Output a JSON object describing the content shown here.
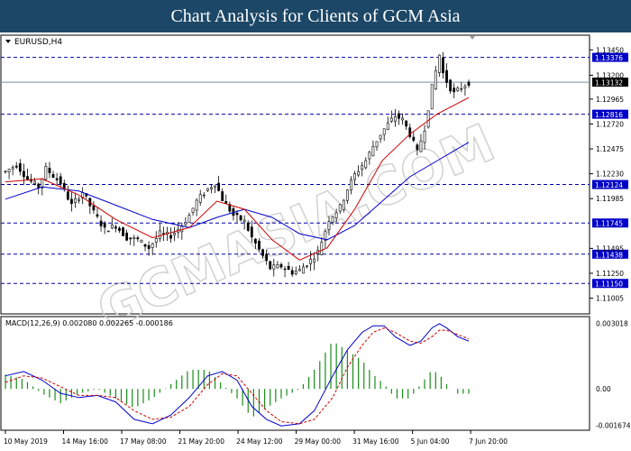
{
  "header": {
    "title": "Chart Analysis for Clients of GCM Asia"
  },
  "watermark": "GCMASIA.COM",
  "chart_data": [
    {
      "type": "candlestick",
      "title": "EURUSD,H4",
      "ylim": [
        1.1085,
        1.1355
      ],
      "y_ticks": [
        "1.13450",
        "1.13200",
        "1.12965",
        "1.12720",
        "1.12475",
        "1.12230",
        "1.11985",
        "1.11495",
        "1.11250",
        "1.11005"
      ],
      "current_price": "1.13132",
      "levels": [
        "1.13376",
        "1.12816",
        "1.12124",
        "1.11745",
        "1.11438",
        "1.11150"
      ],
      "colors": {
        "up": "#ffffff",
        "down": "#000000",
        "ma_fast": "#cc0000",
        "ma_slow": "#0000cc",
        "level": "#0000aa",
        "price_line": "#7a8da6"
      },
      "close_path": [
        [
          0,
          1.1225
        ],
        [
          6,
          1.1232
        ],
        [
          12,
          1.1218
        ],
        [
          18,
          1.121
        ],
        [
          22,
          1.1228
        ],
        [
          30,
          1.1214
        ],
        [
          36,
          1.1192
        ],
        [
          42,
          1.1205
        ],
        [
          48,
          1.1185
        ],
        [
          54,
          1.1168
        ],
        [
          60,
          1.1172
        ],
        [
          66,
          1.116
        ],
        [
          72,
          1.1158
        ],
        [
          78,
          1.115
        ],
        [
          84,
          1.1164
        ],
        [
          90,
          1.1162
        ],
        [
          96,
          1.1172
        ],
        [
          100,
          1.1182
        ],
        [
          104,
          1.1196
        ],
        [
          110,
          1.1208
        ],
        [
          114,
          1.1214
        ],
        [
          118,
          1.1198
        ],
        [
          124,
          1.1182
        ],
        [
          130,
          1.1176
        ],
        [
          134,
          1.116
        ],
        [
          140,
          1.1142
        ],
        [
          144,
          1.113
        ],
        [
          150,
          1.1132
        ],
        [
          156,
          1.1126
        ],
        [
          160,
          1.1128
        ],
        [
          166,
          1.1138
        ],
        [
          170,
          1.1146
        ],
        [
          176,
          1.1178
        ],
        [
          182,
          1.119
        ],
        [
          186,
          1.1208
        ],
        [
          190,
          1.1222
        ],
        [
          196,
          1.1236
        ],
        [
          200,
          1.125
        ],
        [
          204,
          1.1262
        ],
        [
          208,
          1.1272
        ],
        [
          212,
          1.128
        ],
        [
          216,
          1.1276
        ],
        [
          220,
          1.1262
        ],
        [
          224,
          1.1244
        ],
        [
          228,
          1.1268
        ],
        [
          232,
          1.1308
        ],
        [
          236,
          1.134
        ],
        [
          238,
          1.1322
        ],
        [
          241,
          1.131
        ],
        [
          244,
          1.1302
        ],
        [
          248,
          1.1308
        ],
        [
          252,
          1.1313
        ]
      ],
      "ma_fast": [
        [
          0,
          1.1215
        ],
        [
          20,
          1.1218
        ],
        [
          40,
          1.1202
        ],
        [
          60,
          1.1178
        ],
        [
          80,
          1.116
        ],
        [
          100,
          1.117
        ],
        [
          115,
          1.1196
        ],
        [
          130,
          1.1188
        ],
        [
          145,
          1.1158
        ],
        [
          160,
          1.1138
        ],
        [
          175,
          1.115
        ],
        [
          190,
          1.1188
        ],
        [
          205,
          1.1236
        ],
        [
          220,
          1.1262
        ],
        [
          235,
          1.1282
        ],
        [
          252,
          1.1298
        ]
      ],
      "ma_slow": [
        [
          0,
          1.1198
        ],
        [
          20,
          1.121
        ],
        [
          40,
          1.1206
        ],
        [
          60,
          1.1192
        ],
        [
          80,
          1.1178
        ],
        [
          100,
          1.117
        ],
        [
          115,
          1.118
        ],
        [
          130,
          1.1188
        ],
        [
          145,
          1.118
        ],
        [
          160,
          1.1164
        ],
        [
          175,
          1.1158
        ],
        [
          190,
          1.1172
        ],
        [
          205,
          1.1196
        ],
        [
          220,
          1.122
        ],
        [
          235,
          1.1236
        ],
        [
          252,
          1.1254
        ]
      ]
    },
    {
      "type": "macd",
      "title": "MACD(12,26,9) 0.002080 0.002265 -0.000186",
      "ylim": [
        -0.0019,
        0.0032
      ],
      "y_ticks": [
        "0.003018",
        "0.00",
        "-0.001674"
      ],
      "colors": {
        "histogram": "#1a8c1a",
        "macd": "#0000cc",
        "signal": "#cc0000"
      },
      "macd_line": [
        [
          0,
          0.0006
        ],
        [
          10,
          0.0008
        ],
        [
          20,
          0.0004
        ],
        [
          30,
          -0.0002
        ],
        [
          40,
          -0.0004
        ],
        [
          50,
          -0.0003
        ],
        [
          60,
          -0.0006
        ],
        [
          70,
          -0.0014
        ],
        [
          80,
          -0.0016
        ],
        [
          90,
          -0.0012
        ],
        [
          100,
          -0.0004
        ],
        [
          110,
          0.0006
        ],
        [
          118,
          0.0008
        ],
        [
          126,
          0.0004
        ],
        [
          134,
          -0.0008
        ],
        [
          142,
          -0.0014
        ],
        [
          150,
          -0.0017
        ],
        [
          160,
          -0.0016
        ],
        [
          168,
          -0.001
        ],
        [
          178,
          0.0006
        ],
        [
          186,
          0.0018
        ],
        [
          194,
          0.0026
        ],
        [
          200,
          0.0029
        ],
        [
          206,
          0.0029
        ],
        [
          212,
          0.0024
        ],
        [
          220,
          0.002
        ],
        [
          226,
          0.0022
        ],
        [
          232,
          0.0028
        ],
        [
          236,
          0.003
        ],
        [
          240,
          0.0028
        ],
        [
          246,
          0.0024
        ],
        [
          252,
          0.0022
        ]
      ],
      "signal_line": [
        [
          0,
          0.0003
        ],
        [
          10,
          0.0006
        ],
        [
          20,
          0.0005
        ],
        [
          30,
          0.0001
        ],
        [
          40,
          -0.0003
        ],
        [
          50,
          -0.0003
        ],
        [
          60,
          -0.0004
        ],
        [
          70,
          -0.001
        ],
        [
          80,
          -0.0014
        ],
        [
          90,
          -0.0013
        ],
        [
          100,
          -0.0008
        ],
        [
          110,
          0.0002
        ],
        [
          118,
          0.0007
        ],
        [
          126,
          0.0006
        ],
        [
          134,
          -0.0002
        ],
        [
          142,
          -0.001
        ],
        [
          150,
          -0.0015
        ],
        [
          160,
          -0.0016
        ],
        [
          168,
          -0.0014
        ],
        [
          178,
          -0.0004
        ],
        [
          186,
          0.001
        ],
        [
          194,
          0.002
        ],
        [
          200,
          0.0026
        ],
        [
          206,
          0.0028
        ],
        [
          212,
          0.0026
        ],
        [
          220,
          0.0022
        ],
        [
          226,
          0.0021
        ],
        [
          232,
          0.0024
        ],
        [
          236,
          0.0027
        ],
        [
          240,
          0.0027
        ],
        [
          246,
          0.0025
        ],
        [
          252,
          0.0023
        ]
      ]
    }
  ],
  "x_axis": {
    "ticks": [
      "10 May 2019",
      "14 May 16:00",
      "17 May 08:00",
      "21 May 20:00",
      "24 May 12:00",
      "29 May 00:00",
      "31 May 16:00",
      "5 Jun 04:00",
      "7 Jun 20:00"
    ]
  }
}
